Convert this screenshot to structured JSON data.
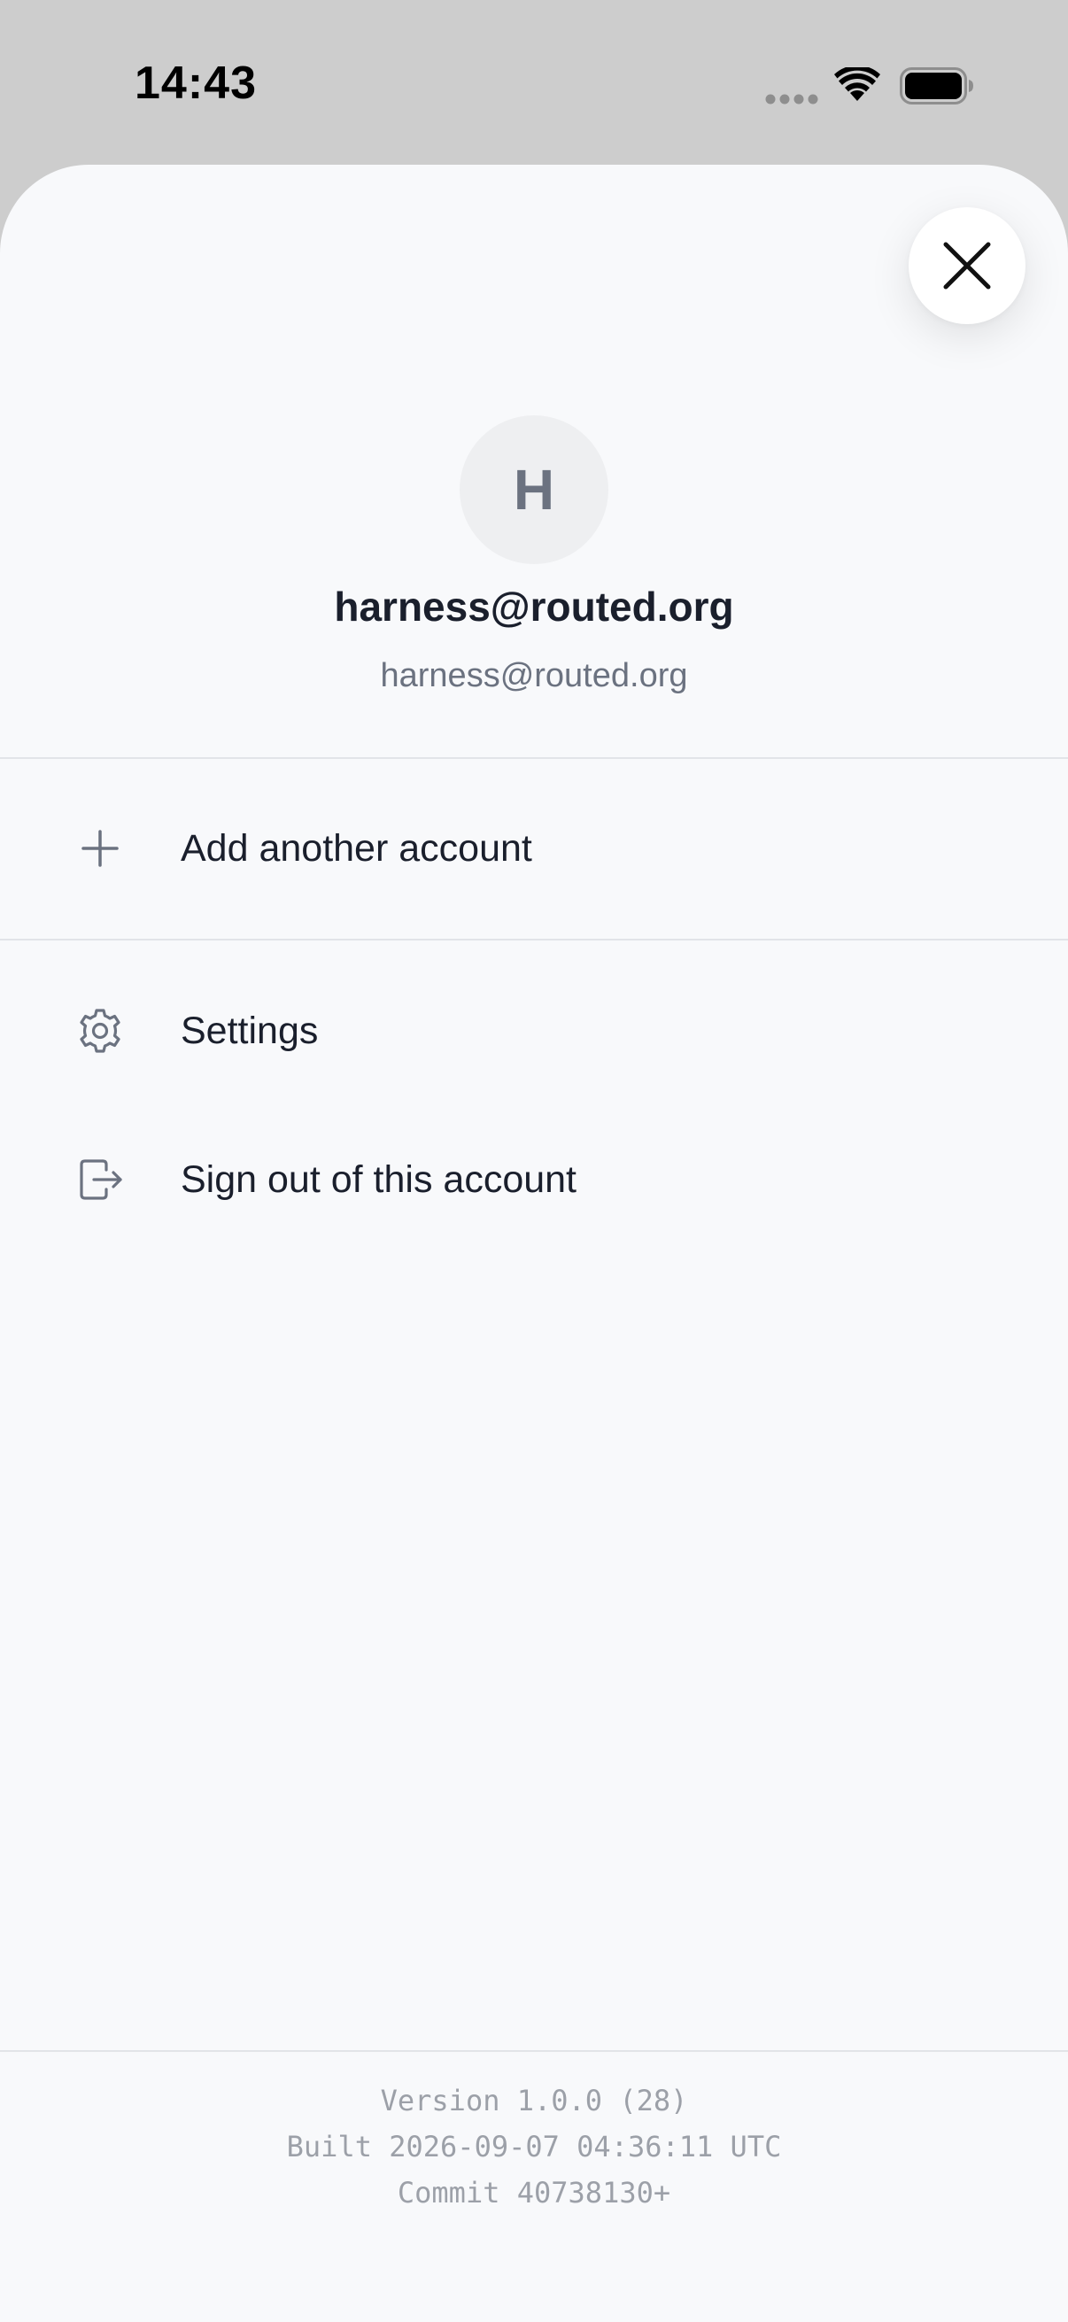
{
  "status_bar": {
    "time": "14:43",
    "signal_icon": "cellular-signal-icon",
    "wifi_icon": "wifi-icon",
    "battery_icon": "battery-icon"
  },
  "sheet": {
    "close_icon": "close-icon",
    "avatar_initial": "H",
    "account_name": "harness@routed.org",
    "account_email": "harness@routed.org",
    "menu": {
      "add_account": {
        "icon": "plus-icon",
        "label": "Add another account"
      },
      "settings": {
        "icon": "gear-icon",
        "label": "Settings"
      },
      "sign_out": {
        "icon": "sign-out-icon",
        "label": "Sign out of this account"
      }
    },
    "footer": {
      "version": "Version 1.0.0 (28)",
      "built": "Built 2026-09-07 04:36:11 UTC",
      "commit": "Commit 40738130+"
    }
  },
  "colors": {
    "background": "#cdcdcd",
    "sheet": "#f8f9fb",
    "text_primary": "#1a1f2c",
    "text_secondary": "#6b7280",
    "footer_text": "#9ca0a8",
    "divider": "#e2e4e8"
  }
}
